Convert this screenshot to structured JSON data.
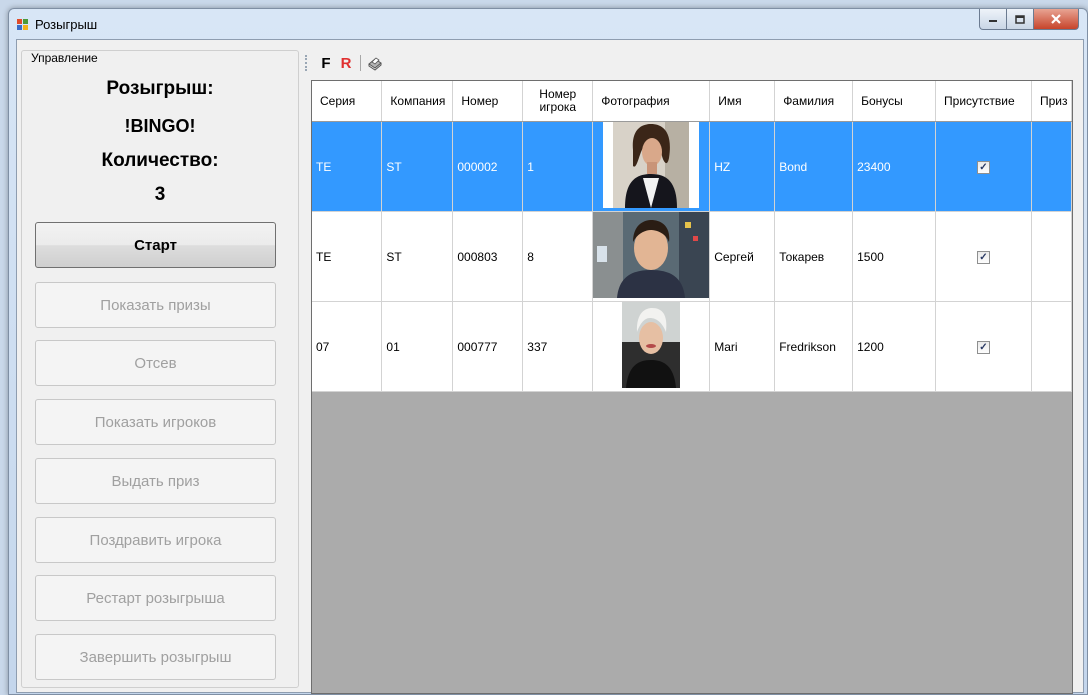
{
  "window": {
    "title": "Розыгрыш"
  },
  "group": {
    "legend": "Управление"
  },
  "info": {
    "draw_label": "Розыгрыш:",
    "draw_name": "!BINGO!",
    "count_label": "Количество:",
    "count_value": "3"
  },
  "buttons": {
    "start": "Старт",
    "show_prizes": "Показать призы",
    "screening": "Отсев",
    "show_players": "Показать игроков",
    "give_prize": "Выдать приз",
    "congratulate": "Поздравить игрока",
    "restart": "Рестарт розыгрыша",
    "finish": "Завершить розыгрыш"
  },
  "toolbar": {
    "f_label": "F",
    "r_label": "R",
    "colors": {
      "f": "#000000",
      "r": "#e03030"
    }
  },
  "grid": {
    "columns": [
      "Серия",
      "Компания",
      "Номер",
      "Номер игрока",
      "Фотография",
      "Имя",
      "Фамилия",
      "Бонусы",
      "Присутствие",
      "Приз"
    ],
    "rows": [
      {
        "series": "TE",
        "company": "ST",
        "number": "000002",
        "player_number": "1",
        "first_name": "HZ",
        "last_name": "Bond",
        "bonus": "23400",
        "present": true,
        "prize": "",
        "selected": true
      },
      {
        "series": "TE",
        "company": "ST",
        "number": "000803",
        "player_number": "8",
        "first_name": "Сергей",
        "last_name": "Токарев",
        "bonus": "1500",
        "present": true,
        "prize": "",
        "selected": false
      },
      {
        "series": "07",
        "company": "01",
        "number": "000777",
        "player_number": "337",
        "first_name": "Mari",
        "last_name": "Fredrikson",
        "bonus": "1200",
        "present": true,
        "prize": "",
        "selected": false
      }
    ],
    "selection_color": "#3399ff"
  }
}
